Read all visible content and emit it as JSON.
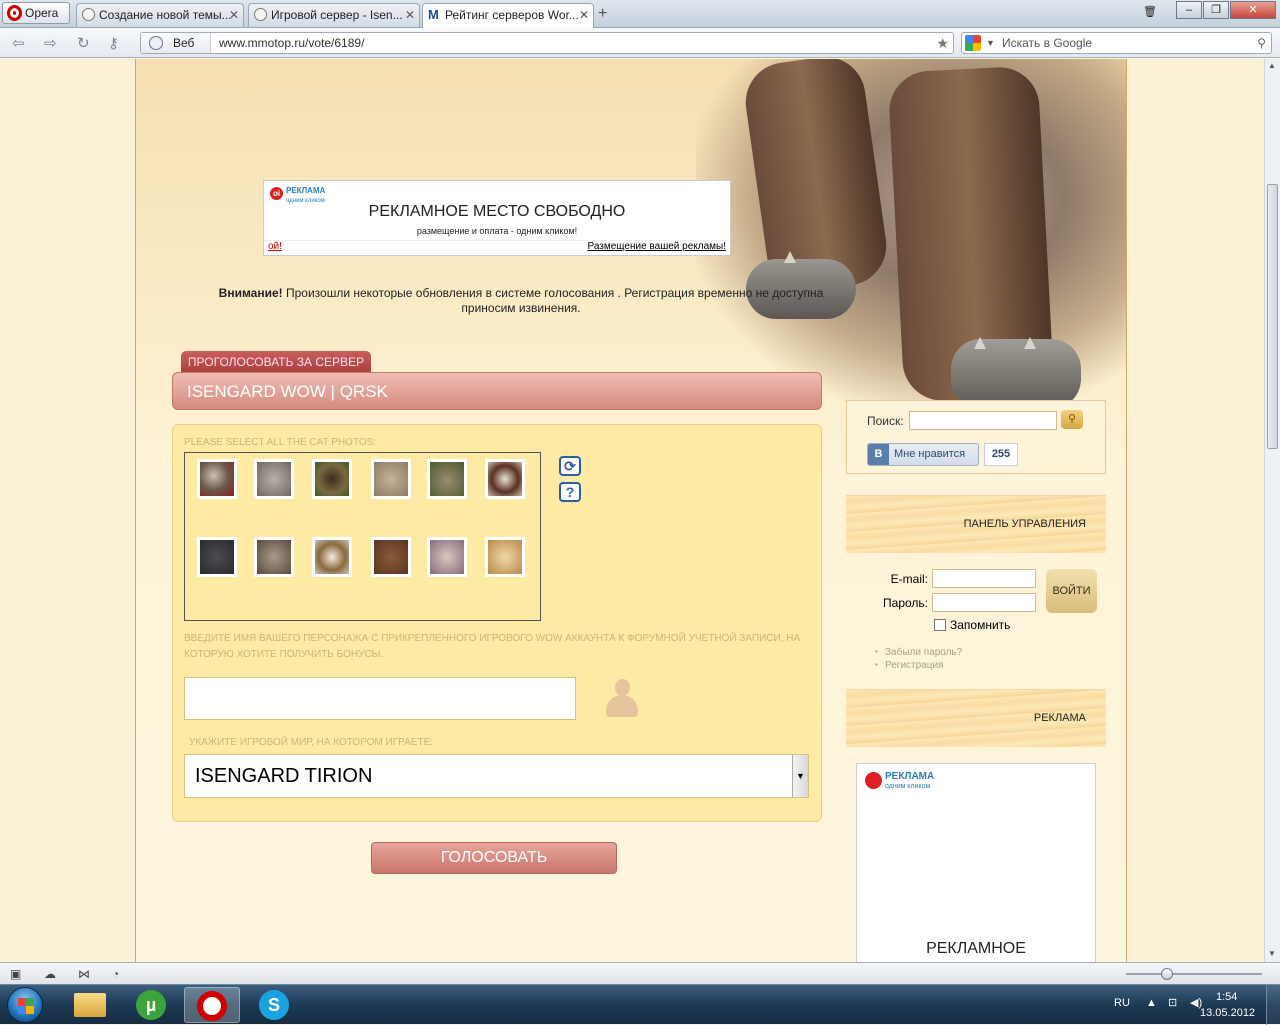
{
  "browser": {
    "menu_label": "Opera",
    "tabs": [
      {
        "label": "Создание новой темы..."
      },
      {
        "label": "Игровой сервер - Isen..."
      },
      {
        "label": "Рейтинг серверов Wor..."
      }
    ],
    "address": {
      "prefix": "Веб",
      "url": "www.mmotop.ru/vote/6189/"
    },
    "search": {
      "placeholder": "Искать в Google"
    }
  },
  "ad_banner": {
    "logo": "РЕКЛАМА",
    "logo_sub": "одним кликом",
    "headline": "РЕКЛАМНОЕ МЕСТО СВОБОДНО",
    "subline": "размещение и оплата - одним кликом!",
    "link_left": "ой!",
    "link_right": "Размещение вашей рекламы!"
  },
  "notice": {
    "bold": "Внимание!",
    "text": " Произошли некоторые обновления в системе голосования . Регистрация временно не доступна",
    "line2": "приносим извинения."
  },
  "vote": {
    "tab_label": "ПРОГОЛОСОВАТЬ ЗА СЕРВЕР",
    "server_name": "ISENGARD WOW | QRSK",
    "captcha_prompt": "PLEASE SELECT ALL THE CAT PHOTOS:",
    "char_prompt": "ВВЕДИТЕ ИМЯ ВАШЕГО ПЕРСОНАЖА С ПРИКРЕПЛЕННОГО ИГРОВОГО WOW АККАУНТА К ФОРУМНОЙ УЧЕТНОЙ ЗАПИСИ, НА КОТОРУЮ ХОТИТЕ ПОЛУЧИТЬ БОНУСЫ.",
    "char_value": "",
    "realm_prompt": "УКАЖИТЕ ИГРОВОЙ МИР, НА КОТОРОМ ИГРАЕТЕ:",
    "realm_selected": "ISENGARD TIRION",
    "submit_label": "ГОЛОСОВАТЬ",
    "refresh_icon": "refresh-icon",
    "help_label": "?"
  },
  "sidebar": {
    "search_label": "Поиск:",
    "search_value": "",
    "vk_logo": "В",
    "vk_like": "Мне нравится",
    "vk_count": "255",
    "panel_title": "ПАНЕЛЬ УПРАВЛЕНИЯ",
    "email_label": "E-mail:",
    "password_label": "Пароль:",
    "login_button": "ВОЙТИ",
    "remember_label": "Запомнить",
    "forgot_link": "Забыли пароль?",
    "register_link": "Регистрация",
    "ad_title": "РЕКЛАМА",
    "ad_box_logo": "РЕКЛАМА",
    "ad_box_logo_sub": "одним кликом",
    "ad_box_text": "РЕКЛАМНОЕ"
  },
  "taskbar": {
    "lang": "RU",
    "time": "1:54",
    "date": "13.05.2012"
  }
}
